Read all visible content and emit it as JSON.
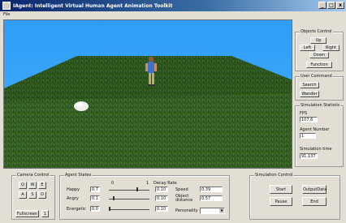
{
  "window": {
    "title": "IAgent: Intelligent Virtual Human Agent Animation Toolkit",
    "menu": [
      "File"
    ],
    "controls": [
      "_",
      "□",
      "x"
    ]
  },
  "objects_control": {
    "title": "Objects Control",
    "up": "Up",
    "left": "Left",
    "right": "Right",
    "down": "Down",
    "function": "Function"
  },
  "user_command": {
    "title": "User Command",
    "search": "Search",
    "wander": "Wander"
  },
  "simulation_statistic": {
    "title": "Simulation Statistic",
    "fps_label": "FPS",
    "fps_value": "107.6",
    "agent_number_label": "Agent Number",
    "agent_number_value": "1",
    "simulation_time_label": "Simulation time",
    "simulation_time_value": "91.137"
  },
  "camera_control": {
    "title": "Camera Control",
    "keys_row1": [
      "Q",
      "W",
      "E"
    ],
    "keys_row2": [
      "A",
      "S",
      "D"
    ],
    "fullscreen": "Fullscreen",
    "fullscreen_toggle": "1"
  },
  "agent_states": {
    "title": "Agent States",
    "scale_min": "0",
    "scale_max": "1",
    "decay_label": "Decay Rate",
    "rows": [
      {
        "label": "Happy",
        "value": "0.7",
        "decay": "0.10",
        "level": 0.7
      },
      {
        "label": "Angry",
        "value": "0.1",
        "decay": "0.10",
        "level": 0.1
      },
      {
        "label": "Energetic",
        "value": "0.0",
        "decay": "0.10",
        "level": 0.0
      }
    ],
    "speed_label": "Speed",
    "speed_value": "0.39",
    "object_distance_label": "Object distance",
    "object_distance_value": "0.57",
    "personality_label": "Personality",
    "personality_value": ""
  },
  "simulation_control": {
    "title": "Simulation Control",
    "start": "Start",
    "pause": "Pause",
    "output_data": "OutputData",
    "end": "End"
  },
  "colors": {
    "sky": "#3aa7ff",
    "grass": "#2f5a1c",
    "titlebar": "#0a246a"
  }
}
